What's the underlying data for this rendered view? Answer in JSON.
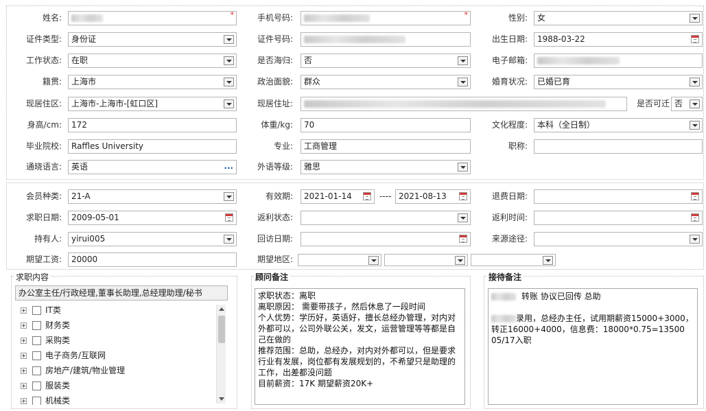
{
  "basic": {
    "name_label": "姓名:",
    "phone_label": "手机号码:",
    "gender_label": "性别:",
    "gender_value": "女",
    "idtype_label": "证件类型:",
    "idtype_value": "身份证",
    "idno_label": "证件号码:",
    "birth_label": "出生日期:",
    "birth_value": "1988-03-22",
    "work_label": "工作状态:",
    "work_value": "在职",
    "returnee_label": "是否海归:",
    "returnee_value": "否",
    "email_label": "电子邮箱:",
    "native_label": "籍贯:",
    "native_value": "上海市",
    "political_label": "政治面貌:",
    "political_value": "群众",
    "marital_label": "婚育状况:",
    "marital_value": "已婚已育",
    "residence_label": "现居住区:",
    "residence_value": "上海市-上海市-[虹口区]",
    "address_label": "现居住址:",
    "relocate_label": "是否可迁",
    "relocate_value": "否",
    "height_label": "身高/cm:",
    "height_value": "172",
    "weight_label": "体重/kg:",
    "weight_value": "70",
    "education_label": "文化程度:",
    "education_value": "本科（全日制）",
    "school_label": "毕业院校:",
    "school_value": "Raffles University",
    "major_label": "专业:",
    "major_value": "工商管理",
    "title_label": "职称:",
    "language_label": "通晓语言:",
    "language_value": "英语",
    "language_more": "...",
    "lang_level_label": "外语等级:",
    "lang_level_value": "雅思"
  },
  "member": {
    "type_label": "会员种类:",
    "type_value": "21-A",
    "valid_label": "有效期:",
    "valid_from": "2021-01-14",
    "valid_sep": "----",
    "valid_to": "2021-08-13",
    "refund_label": "退费日期:",
    "jobseek_date_label": "求职日期:",
    "jobseek_date_value": "2009-05-01",
    "rebate_status_label": "返利状态:",
    "rebate_time_label": "返利时间:",
    "holder_label": "持有人:",
    "holder_value": "yirui005",
    "visit_label": "回访日期:",
    "source_label": "来源途径:",
    "salary_label": "期望工资:",
    "salary_value": "20000",
    "region_label": "期望地区:"
  },
  "job": {
    "title": "求职内容",
    "summary": "办公室主任/行政经理,董事长助理,总经理助理/秘书",
    "categories": [
      "IT类",
      "财务类",
      "采购类",
      "电子商务/互联网",
      "房地产/建筑/物业管理",
      "服装类",
      "机械类"
    ]
  },
  "consultant": {
    "title": "顾问备注",
    "lines": [
      "求职状态：离职",
      "离职原因：        需要带孩子，然后休息了一段时间",
      "个人优势：学历好，英语好，擅长总经办管理，对内对外都可以，公司外联公关，发文，运营管理等等都是自己在做的",
      "推荐范围：总助，总经办，对内对外都可以，但是要求行业有发展，岗位都有发展规划的，不希望只是助理的工作，出差都没问题",
      "目前薪资：17K    期望薪资20K+"
    ]
  },
  "reception": {
    "title": "接待备注",
    "line1": "转账 协议已回传 总助",
    "line2": "录用，总经办主任，试用期薪资15000+3000，转正16000+4000，信息费：18000*0.75=13500",
    "line3": "05/17入职"
  },
  "icons": {
    "dropdown": "chevron-down-icon",
    "calendar": "calendar-icon",
    "expand": "plus-expander-icon",
    "checkbox": "checkbox-icon"
  },
  "colors": {
    "required": "#e02020",
    "border": "#b4b4b4",
    "link": "#2060b0"
  }
}
